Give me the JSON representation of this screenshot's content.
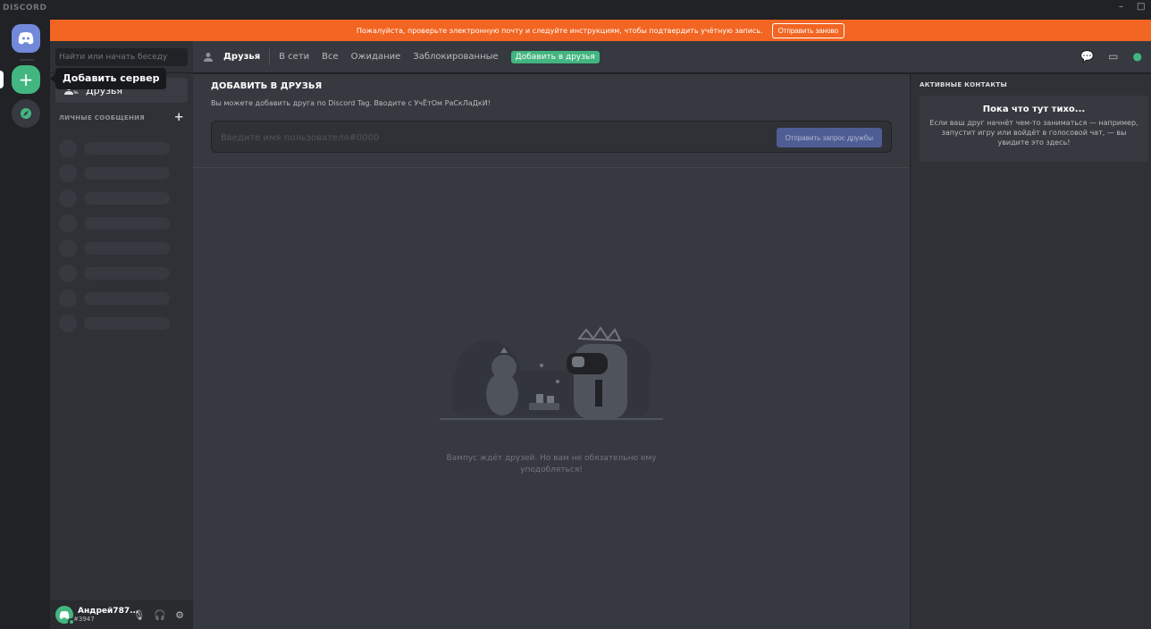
{
  "window": {
    "brand": "DISCORD",
    "minimize": "–",
    "maximize": "□"
  },
  "rail": {
    "add_server_tooltip": "Добавить сервер"
  },
  "notice": {
    "text": "Пожалуйста, проверьте электронную почту и следуйте инструкциям, чтобы подтвердить учётную запись.",
    "button": "Отправить заново",
    "color": "#f26522"
  },
  "sidebar": {
    "search_placeholder": "Найти или начать беседу",
    "friends_label": "Друзья",
    "dm_header": "ЛИЧНЫЕ СООБЩЕНИЯ",
    "dm_add": "+"
  },
  "user": {
    "name": "Андрей787...",
    "tag": "#3947"
  },
  "topbar": {
    "title": "Друзья",
    "tabs": [
      "В сети",
      "Все",
      "Ожидание",
      "Заблокированные"
    ],
    "add_friend_tab": "Добавить в друзья",
    "accent": "#43b581"
  },
  "add_friend": {
    "title": "ДОБАВИТЬ В ДРУЗЬЯ",
    "description": "Вы можете добавить друга по Discord Tag. Вводите с УчЁтОм РаСкЛаДкИ!",
    "placeholder": "Введите имя пользователя#0000",
    "button": "Отправить запрос дружбы"
  },
  "empty_state": {
    "text": "Вампус ждёт друзей. Но вам не обязательно ему уподобляться!"
  },
  "activity": {
    "header": "АКТИВНЫЕ КОНТАКТЫ",
    "card_title": "Пока что тут тихо...",
    "card_text": "Если ваш друг начнёт чем-то заниматься — например, запустит игру или войдёт в голосовой чат, — вы увидите это здесь!"
  }
}
